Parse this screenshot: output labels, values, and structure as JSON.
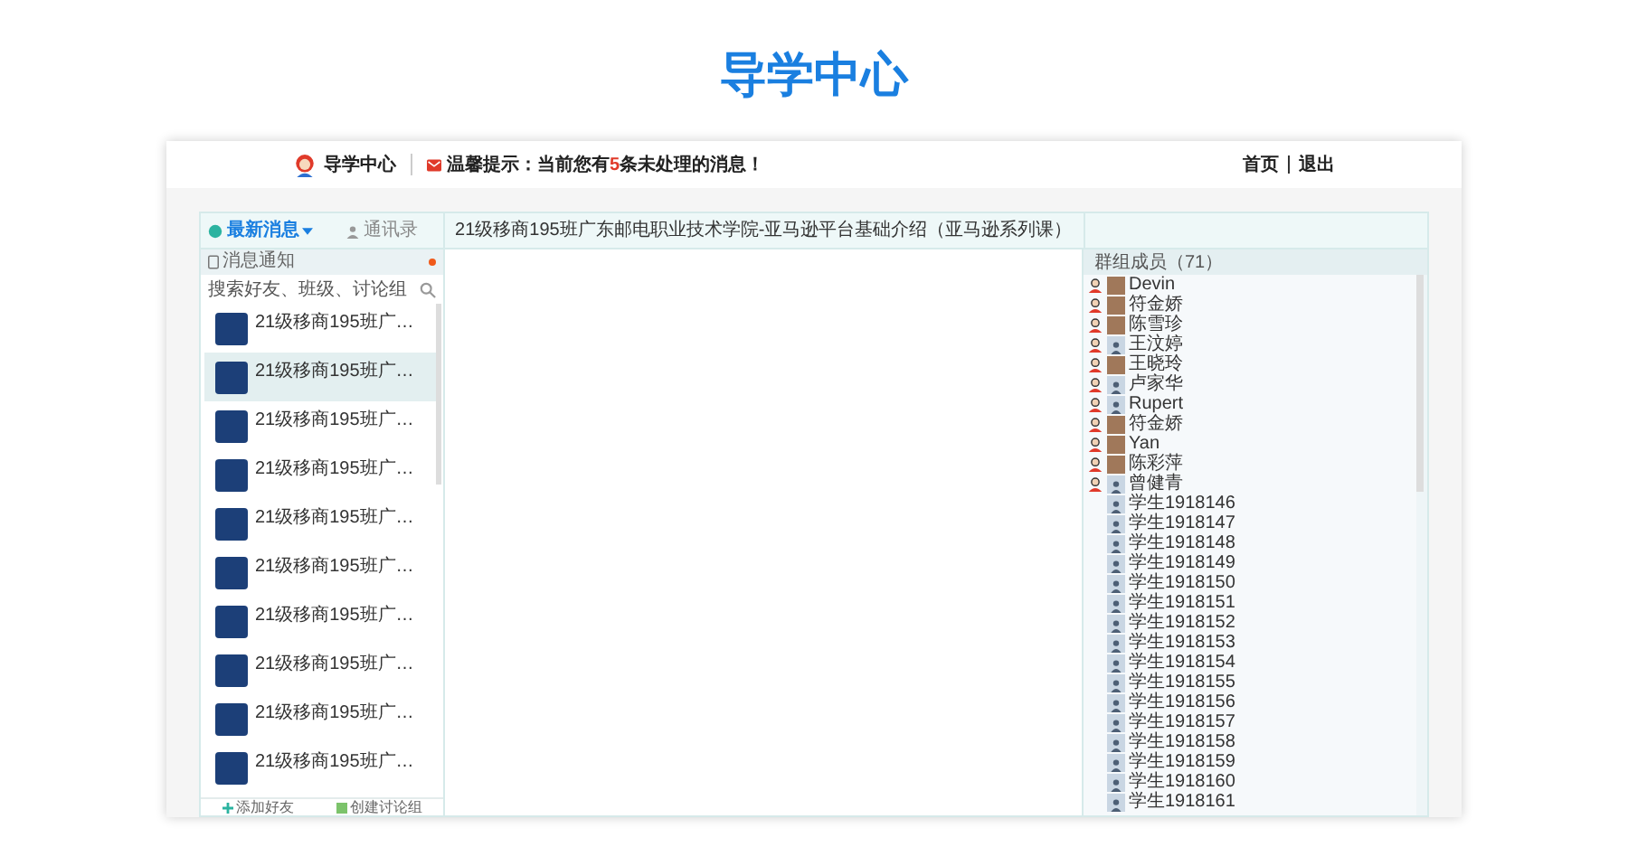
{
  "page_title": "导学中心",
  "header": {
    "app_name": "导学中心",
    "notice_prefix": "温馨提示：当前您有",
    "notice_count": "5",
    "notice_suffix": "条未处理的消息！",
    "links": [
      "首页",
      "退出"
    ]
  },
  "tabs": [
    {
      "label": "最新消息",
      "selected": true,
      "kind": "chat"
    },
    {
      "label": "通讯录",
      "selected": false,
      "kind": "contacts"
    }
  ],
  "notifications": {
    "label": "消息通知",
    "unread": true
  },
  "search": {
    "placeholder": "搜索好友、班级、讨论组"
  },
  "chats": [
    {
      "name": "21级移商195班广…",
      "selected": false
    },
    {
      "name": "21级移商195班广…",
      "selected": true
    },
    {
      "name": "21级移商195班广…",
      "selected": false
    },
    {
      "name": "21级移商195班广…",
      "selected": false
    },
    {
      "name": "21级移商195班广…",
      "selected": false
    },
    {
      "name": "21级移商195班广…",
      "selected": false
    },
    {
      "name": "21级移商195班广…",
      "selected": false
    },
    {
      "name": "21级移商195班广…",
      "selected": false
    },
    {
      "name": "21级移商195班广…",
      "selected": false
    },
    {
      "name": "21级移商195班广…",
      "selected": false
    }
  ],
  "footer_buttons": [
    {
      "label": "添加好友",
      "kind": "add"
    },
    {
      "label": "创建讨论组",
      "kind": "group"
    }
  ],
  "conversation": {
    "title": "21级移商195班广东邮电职业技术学院-亚马逊平台基础介绍（亚马逊系列课）"
  },
  "members": {
    "title": "群组成员（71）",
    "items": [
      {
        "name": "Devin",
        "teacher": true,
        "photo": true
      },
      {
        "name": "符金娇",
        "teacher": true,
        "photo": true
      },
      {
        "name": "陈雪珍",
        "teacher": true,
        "photo": true
      },
      {
        "name": "王汶婷",
        "teacher": true,
        "photo": false
      },
      {
        "name": "王晓玲",
        "teacher": true,
        "photo": true
      },
      {
        "name": "卢家华",
        "teacher": true,
        "photo": false
      },
      {
        "name": "Rupert",
        "teacher": true,
        "photo": false
      },
      {
        "name": "符金娇",
        "teacher": true,
        "photo": true
      },
      {
        "name": "Yan",
        "teacher": true,
        "photo": true
      },
      {
        "name": "陈彩萍",
        "teacher": true,
        "photo": true
      },
      {
        "name": "曾健青",
        "teacher": true,
        "photo": false
      },
      {
        "name": "学生1918146",
        "teacher": false,
        "photo": false
      },
      {
        "name": "学生1918147",
        "teacher": false,
        "photo": false
      },
      {
        "name": "学生1918148",
        "teacher": false,
        "photo": false
      },
      {
        "name": "学生1918149",
        "teacher": false,
        "photo": false
      },
      {
        "name": "学生1918150",
        "teacher": false,
        "photo": false
      },
      {
        "name": "学生1918151",
        "teacher": false,
        "photo": false
      },
      {
        "name": "学生1918152",
        "teacher": false,
        "photo": false
      },
      {
        "name": "学生1918153",
        "teacher": false,
        "photo": false
      },
      {
        "name": "学生1918154",
        "teacher": false,
        "photo": false
      },
      {
        "name": "学生1918155",
        "teacher": false,
        "photo": false
      },
      {
        "name": "学生1918156",
        "teacher": false,
        "photo": false
      },
      {
        "name": "学生1918157",
        "teacher": false,
        "photo": false
      },
      {
        "name": "学生1918158",
        "teacher": false,
        "photo": false
      },
      {
        "name": "学生1918159",
        "teacher": false,
        "photo": false
      },
      {
        "name": "学生1918160",
        "teacher": false,
        "photo": false
      },
      {
        "name": "学生1918161",
        "teacher": false,
        "photo": false
      }
    ]
  }
}
